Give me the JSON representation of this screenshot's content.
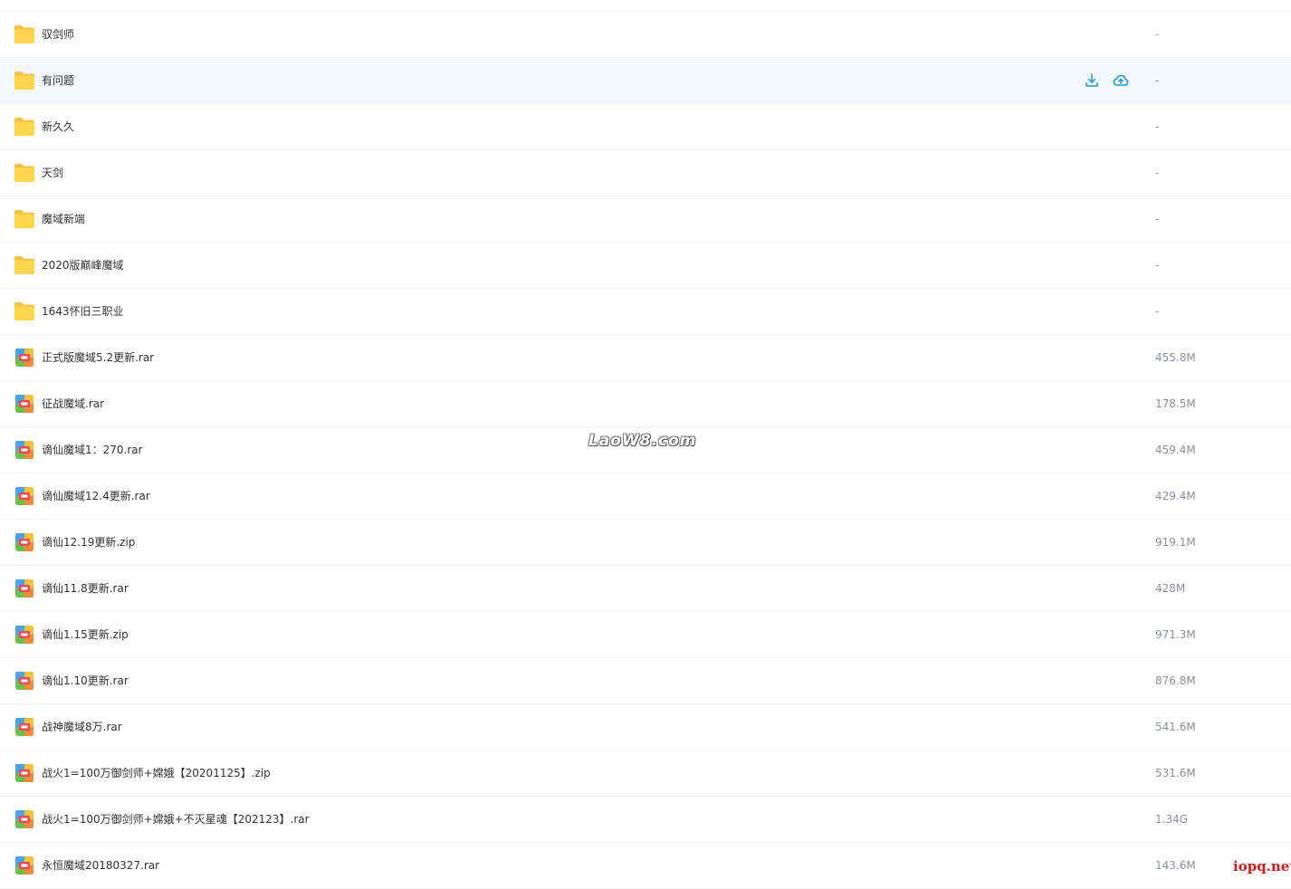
{
  "files": [
    {
      "name": "驭剑师",
      "type": "folder",
      "size": "-",
      "hovered": false
    },
    {
      "name": "有问题",
      "type": "folder",
      "size": "-",
      "hovered": true
    },
    {
      "name": "新久久",
      "type": "folder",
      "size": "-",
      "hovered": false
    },
    {
      "name": "天剑",
      "type": "folder",
      "size": "-",
      "hovered": false
    },
    {
      "name": "魔域新端",
      "type": "folder",
      "size": "-",
      "hovered": false
    },
    {
      "name": "2020版巅峰魔域",
      "type": "folder",
      "size": "-",
      "hovered": false
    },
    {
      "name": "1643怀旧三职业",
      "type": "folder",
      "size": "-",
      "hovered": false
    },
    {
      "name": "正式版魔域5.2更新.rar",
      "type": "archive",
      "size": "455.8M",
      "hovered": false
    },
    {
      "name": "征战魔域.rar",
      "type": "archive",
      "size": "178.5M",
      "hovered": false
    },
    {
      "name": "谪仙魔域1：270.rar",
      "type": "archive",
      "size": "459.4M",
      "hovered": false
    },
    {
      "name": "谪仙魔域12.4更新.rar",
      "type": "archive",
      "size": "429.4M",
      "hovered": false
    },
    {
      "name": "谪仙12.19更新.zip",
      "type": "archive",
      "size": "919.1M",
      "hovered": false
    },
    {
      "name": "谪仙11.8更新.rar",
      "type": "archive",
      "size": "428M",
      "hovered": false
    },
    {
      "name": "谪仙1.15更新.zip",
      "type": "archive",
      "size": "971.3M",
      "hovered": false
    },
    {
      "name": "谪仙1.10更新.rar",
      "type": "archive",
      "size": "876.8M",
      "hovered": false
    },
    {
      "name": "战神魔域8万.rar",
      "type": "archive",
      "size": "541.6M",
      "hovered": false
    },
    {
      "name": "战火1=100万御剑师+嫦娥【20201125】.zip",
      "type": "archive",
      "size": "531.6M",
      "hovered": false
    },
    {
      "name": "战火1=100万御剑师+嫦娥+不灭星魂【202123】.rar",
      "type": "archive",
      "size": "1.34G",
      "hovered": false
    },
    {
      "name": "永恒魔域20180327.rar",
      "type": "archive",
      "size": "143.6M",
      "hovered": false
    }
  ],
  "hover_actions": {
    "download_icon": "download-icon",
    "save_to_cloud_icon": "cloud-upload-icon",
    "accent_color": "#1a9bd7"
  },
  "watermark": "LaoW8.com",
  "corner_mark": "iopq.net"
}
